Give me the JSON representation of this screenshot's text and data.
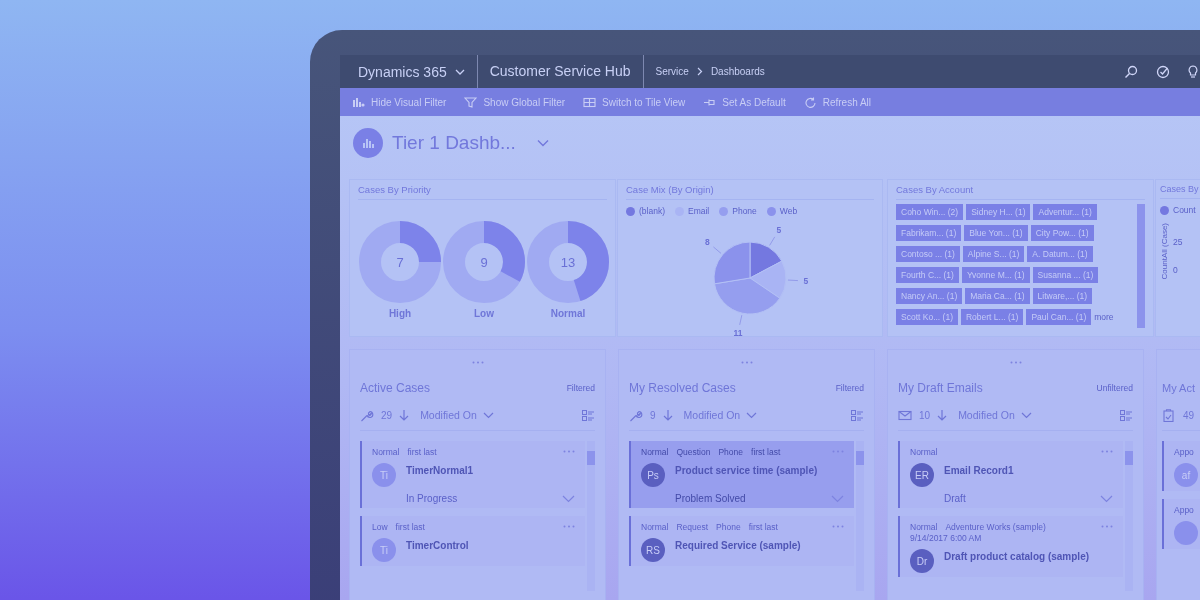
{
  "nav": {
    "app": "Dynamics 365",
    "area": "Customer Service Hub",
    "breadcrumb": [
      "Service",
      "Dashboards"
    ]
  },
  "commands": [
    {
      "label": "Hide Visual Filter",
      "kind": "chart"
    },
    {
      "label": "Show Global Filter",
      "kind": "filter"
    },
    {
      "label": "Switch to Tile View",
      "kind": "tiles"
    },
    {
      "label": "Set As Default",
      "kind": "pin"
    },
    {
      "label": "Refresh All",
      "kind": "refresh"
    }
  ],
  "dashboard": {
    "title": "Tier 1 Dashb..."
  },
  "priority_panel": {
    "title": "Cases By Priority",
    "donuts": [
      {
        "label": "High",
        "total": "7",
        "level": 0.25
      },
      {
        "label": "Low",
        "total": "9",
        "level": 0.33
      },
      {
        "label": "Normal",
        "total": "13",
        "level": 0.45
      }
    ]
  },
  "origin_panel": {
    "legend": [
      {
        "color": "#7478e0"
      },
      {
        "color": "#a9b4f4"
      },
      {
        "color": "#959eef"
      },
      {
        "color": "#8b92ec"
      }
    ],
    "chart_data": {
      "type": "pie",
      "title": "Case Mix (By Origin)",
      "categories": [
        "(blank)",
        "Email",
        "Phone",
        "Web"
      ],
      "series": [
        {
          "values": [
            5,
            5,
            11,
            8
          ]
        }
      ],
      "data_labels": true
    }
  },
  "account_panel": {
    "title": "Cases By Account",
    "tags": [
      "Coho Win... (2)",
      "Sidney H... (1)",
      "Adventur... (1)",
      "Fabrikam... (1)",
      "Blue Yon... (1)",
      "City Pow... (1)",
      "Contoso ... (1)",
      "Alpine S... (1)",
      "A. Datum... (1)",
      "Fourth C... (1)",
      "Yvonne M... (1)",
      "Susanna ... (1)",
      "Nancy An... (1)",
      "Maria Ca... (1)",
      "Litware,... (1)",
      "Scott Ko... (1)",
      "Robert L... (1)",
      "Paul Can... (1)"
    ],
    "more": "more"
  },
  "count_panel": {
    "title": "Cases By",
    "legend": "Count",
    "ylabel": "CountAll (Case)",
    "yticks": [
      "25",
      "0"
    ]
  },
  "streams": [
    {
      "kind": "case",
      "menu": true,
      "title": "Active Cases",
      "filter": "Filtered",
      "count": "29",
      "sort": "Modified On",
      "items": [
        {
          "tags": [
            "Normal",
            "first last"
          ],
          "initials": "Ti",
          "color": "#8a90ec",
          "title": "TimerNormal1",
          "status": "In Progress",
          "selected": false
        },
        {
          "tags": [
            "Low",
            "first last"
          ],
          "initials": "Ti",
          "color": "#8a90ec",
          "title": "TimerControl",
          "selected": false
        }
      ]
    },
    {
      "kind": "case",
      "menu": true,
      "title": "My Resolved Cases",
      "filter": "Filtered",
      "count": "9",
      "sort": "Modified On",
      "items": [
        {
          "tags": [
            "Normal",
            "Question",
            "Phone",
            "first last"
          ],
          "initials": "Ps",
          "color": "#5a5fc0",
          "title": "Product service time (sample)",
          "status": "Problem Solved",
          "selected": true
        },
        {
          "tags": [
            "Normal",
            "Request",
            "Phone",
            "first last"
          ],
          "initials": "RS",
          "color": "#5a5fc0",
          "title": "Required Service (sample)",
          "selected": false
        }
      ]
    },
    {
      "kind": "email",
      "menu": true,
      "title": "My Draft Emails",
      "filter": "Unfiltered",
      "count": "10",
      "sort": "Modified On",
      "items": [
        {
          "tags": [
            "Normal"
          ],
          "initials": "ER",
          "color": "#5a5fc0",
          "title": "Email Record1",
          "status": "Draft",
          "selected": false
        },
        {
          "tags": [
            "Normal",
            "Adventure Works (sample)"
          ],
          "date": "9/14/2017 6:00 AM",
          "initials": "Dr",
          "color": "#5a5fc0",
          "title": "Draft product catalog (sample)",
          "selected": false
        }
      ]
    },
    {
      "kind": "activity",
      "menu": false,
      "title": "My Act",
      "count": "49",
      "items": [
        {
          "tags": [
            "Appo"
          ],
          "initials": "af",
          "color": "#8a90ec",
          "selected": false
        },
        {
          "tags": [
            "Appo"
          ],
          "color": "#8a90ec",
          "selected": false
        }
      ]
    }
  ]
}
